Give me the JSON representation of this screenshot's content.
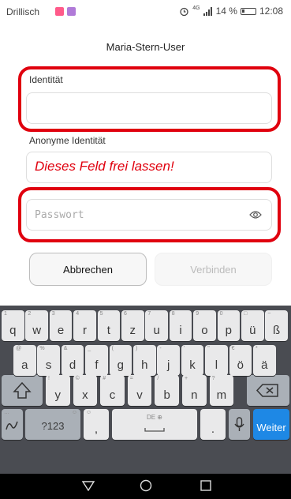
{
  "status": {
    "carrier": "Drillisch",
    "network": "4G",
    "battery": "14 %",
    "time": "12:08",
    "app_icon_colors": [
      "#ff5a8a",
      "#b07ad8"
    ]
  },
  "dialog": {
    "title": "Maria-Stern-User",
    "identity_label": "Identität",
    "identity_value": "",
    "anon_label": "Anonyme Identität",
    "anon_hint": "Dieses Feld frei lassen!",
    "password_placeholder": "Passwort",
    "cancel_label": "Abbrechen",
    "connect_label": "Verbinden"
  },
  "highlight_color": "#e0000e",
  "keyboard": {
    "row1": [
      {
        "m": "q",
        "s": "1"
      },
      {
        "m": "w",
        "s": "2"
      },
      {
        "m": "e",
        "s": "3"
      },
      {
        "m": "r",
        "s": "4"
      },
      {
        "m": "t",
        "s": "5"
      },
      {
        "m": "z",
        "s": "6"
      },
      {
        "m": "u",
        "s": "7"
      },
      {
        "m": "i",
        "s": "8"
      },
      {
        "m": "o",
        "s": "9"
      },
      {
        "m": "p",
        "s": "0"
      },
      {
        "m": "ü",
        "s": "□"
      },
      {
        "m": "ß",
        "s": "~"
      }
    ],
    "row2": [
      {
        "m": "a",
        "s": "@"
      },
      {
        "m": "s",
        "s": "%"
      },
      {
        "m": "d",
        "s": "&"
      },
      {
        "m": "f",
        "s": "_"
      },
      {
        "m": "g",
        "s": "("
      },
      {
        "m": "h",
        "s": ")"
      },
      {
        "m": "j",
        "s": "-"
      },
      {
        "m": "k",
        "s": "'"
      },
      {
        "m": "l",
        "s": "\""
      },
      {
        "m": "ö",
        "s": "€"
      },
      {
        "m": "ä",
        "s": "*"
      }
    ],
    "row3": [
      {
        "m": "y",
        "s": "!"
      },
      {
        "m": "x",
        "s": "©"
      },
      {
        "m": "c",
        "s": "#"
      },
      {
        "m": "v",
        "s": "="
      },
      {
        "m": "b",
        "s": "/"
      },
      {
        "m": "n",
        "s": "+"
      },
      {
        "m": "m",
        "s": "?"
      }
    ],
    "symbols_label": "?123",
    "comma": ",",
    "space_label": "DE ⊕",
    "period": ".",
    "enter_label": "Weiter",
    "symbols_sub": "☺",
    "comma_sub": "☺",
    "handwriting_sub": "…"
  },
  "icons": {
    "eye": "eye-icon",
    "shift": "shift-icon",
    "backspace": "backspace-icon",
    "handwriting": "handwriting-icon",
    "mic": "microphone-icon",
    "back": "back-triangle-icon",
    "home": "home-circle-icon",
    "recents": "recents-square-icon"
  }
}
